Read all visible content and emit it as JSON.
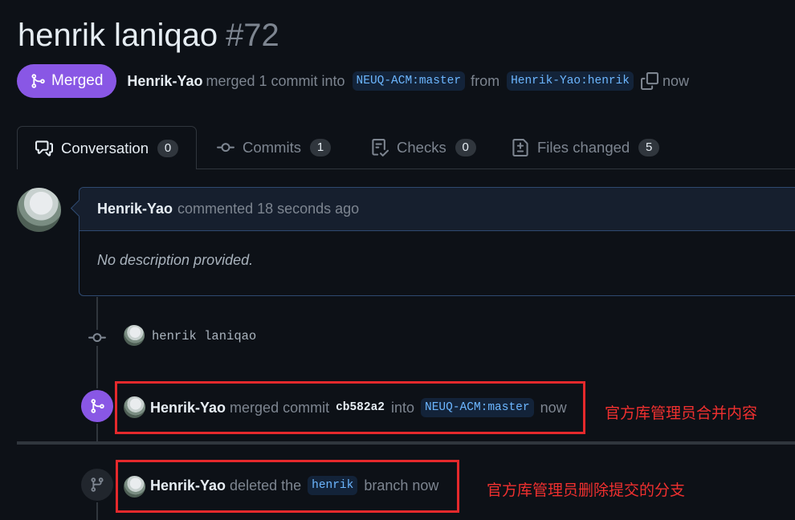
{
  "pr": {
    "title": "henrik laniqao",
    "number": "#72",
    "status": "Merged",
    "author": "Henrik-Yao",
    "merge_text": "merged 1 commit into",
    "base_branch": "NEUQ-ACM:master",
    "from_text": "from",
    "head_branch": "Henrik-Yao:henrik",
    "time": "now"
  },
  "tabs": [
    {
      "label": "Conversation",
      "count": "0",
      "icon": "comment-discussion-icon"
    },
    {
      "label": "Commits",
      "count": "1",
      "icon": "git-commit-icon"
    },
    {
      "label": "Checks",
      "count": "0",
      "icon": "checklist-icon"
    },
    {
      "label": "Files changed",
      "count": "5",
      "icon": "file-diff-icon"
    }
  ],
  "comment": {
    "author": "Henrik-Yao",
    "meta": "commented 18 seconds ago",
    "body": "No description provided."
  },
  "commit": {
    "message": "henrik laniqao"
  },
  "merge_event": {
    "author": "Henrik-Yao",
    "text1": "merged commit",
    "sha": "cb582a2",
    "text2": "into",
    "branch": "NEUQ-ACM:master",
    "time": "now"
  },
  "delete_event": {
    "author": "Henrik-Yao",
    "text1": "deleted the",
    "branch": "henrik",
    "text2": "branch now"
  },
  "annotations": {
    "merge_note": "官方库管理员合并内容",
    "delete_note": "官方库管理员删除提交的分支"
  },
  "colors": {
    "merged_purple": "#8957e5",
    "annotation_red": "#e5292c",
    "branch_blue": "#6cb6ff"
  }
}
